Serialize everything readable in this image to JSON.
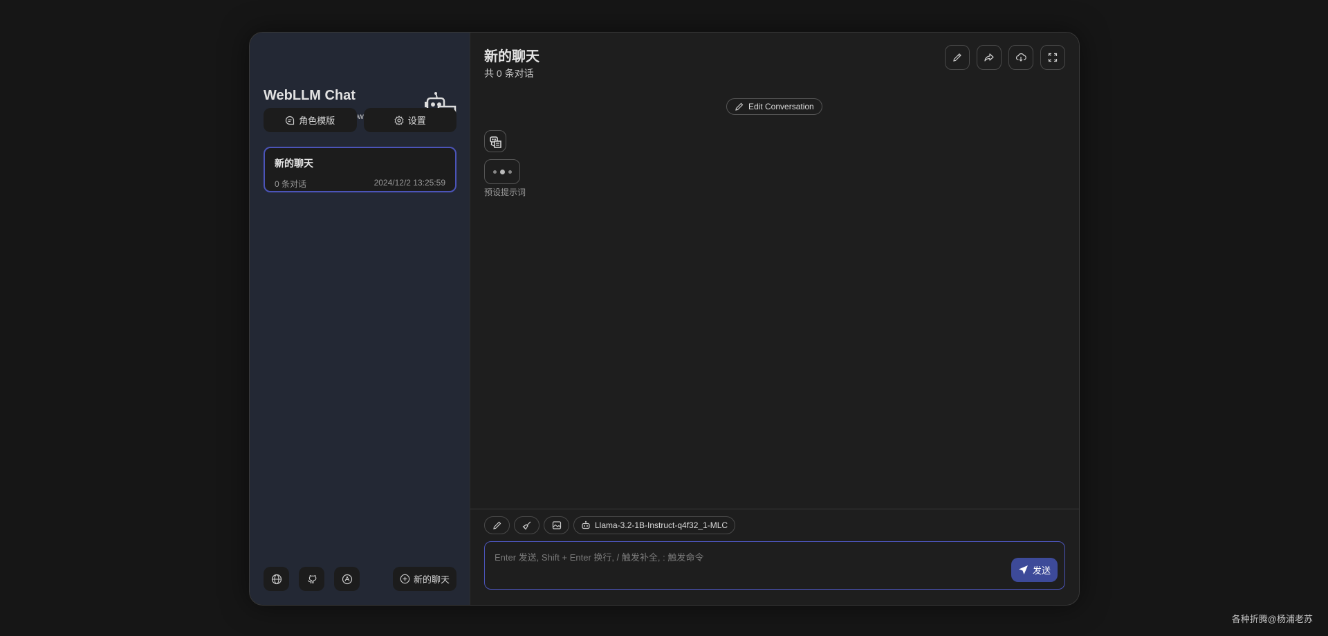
{
  "sidebar": {
    "title": "WebLLM Chat",
    "subtitle": "AI Models Running in Browser",
    "buttons": {
      "templates": "角色模版",
      "settings": "设置"
    },
    "chat_items": [
      {
        "title": "新的聊天",
        "count": "0 条对话",
        "time": "2024/12/2 13:25:59"
      }
    ],
    "new_chat": "新的聊天"
  },
  "header": {
    "title": "新的聊天",
    "subtitle": "共 0 条对话"
  },
  "chat": {
    "edit_conversation": "Edit Conversation",
    "preset_prompt": "预设提示词"
  },
  "input": {
    "model": "Llama-3.2-1B-Instruct-q4f32_1-MLC",
    "placeholder": "Enter 发送, Shift + Enter 换行, / 触发补全, : 触发命令",
    "send": "发送"
  },
  "watermark": "各种折腾@杨浦老苏",
  "colors": {
    "accent": "#4b54b8",
    "send_bg": "#3d4a99",
    "sidebar_bg": "#232834"
  }
}
